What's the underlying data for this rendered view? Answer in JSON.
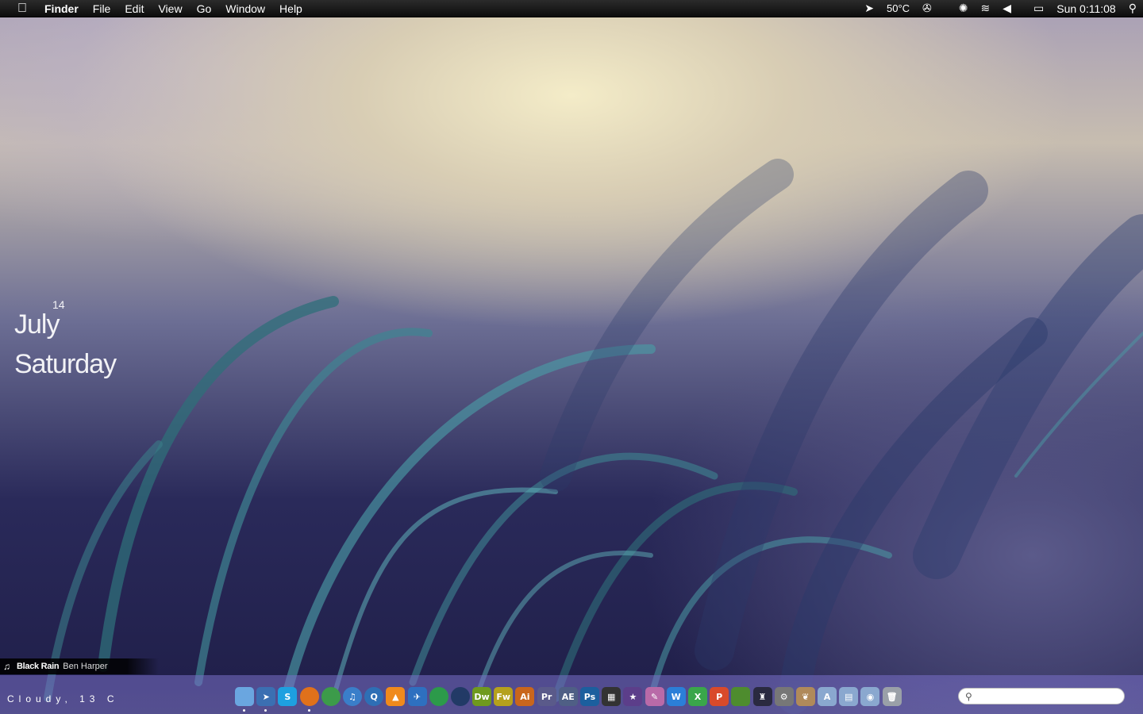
{
  "menubar": {
    "apple_icon": "apple-icon",
    "app_name": "Finder",
    "menus": [
      "File",
      "Edit",
      "View",
      "Go",
      "Window",
      "Help"
    ],
    "temperature": "50°C",
    "clock": "Sun 0:11:08",
    "status_icons": [
      "cursor-icon",
      "fan-icon",
      "network-icon",
      "wifi-icon",
      "volume-icon",
      "battery-icon",
      "spotlight-icon"
    ]
  },
  "date_widget": {
    "day": "14",
    "month": "July",
    "weekday": "Saturday"
  },
  "now_playing": {
    "track": "Black Rain",
    "artist": "Ben Harper"
  },
  "weather": {
    "text": "Cloudy, 13 C"
  },
  "dock": {
    "apps": [
      {
        "name": "finder",
        "label": "",
        "color": "#6aa6e0",
        "running": true
      },
      {
        "name": "cursor-app",
        "label": "➤",
        "color": "#3b6fb2",
        "running": true
      },
      {
        "name": "skype",
        "label": "S",
        "color": "#1ea0e0",
        "running": false
      },
      {
        "name": "firefox",
        "label": "",
        "color": "#e0711b",
        "running": true
      },
      {
        "name": "chrome",
        "label": "",
        "color": "#3c9b4a",
        "running": false
      },
      {
        "name": "itunes",
        "label": "♫",
        "color": "#3a7ec9",
        "running": false
      },
      {
        "name": "quicktime",
        "label": "Q",
        "color": "#2e6fb5",
        "running": false
      },
      {
        "name": "vlc",
        "label": "▲",
        "color": "#f08a1c",
        "running": false
      },
      {
        "name": "adium",
        "label": "✈",
        "color": "#2e70c0",
        "running": false
      },
      {
        "name": "camino",
        "label": "",
        "color": "#2c9a4a",
        "running": false
      },
      {
        "name": "cinema4d",
        "label": "",
        "color": "#223a66",
        "running": false
      },
      {
        "name": "dreamweaver",
        "label": "Dw",
        "color": "#6f9a1e",
        "running": false
      },
      {
        "name": "fireworks",
        "label": "Fw",
        "color": "#b5a11d",
        "running": false
      },
      {
        "name": "illustrator",
        "label": "Ai",
        "color": "#c9661c",
        "running": false
      },
      {
        "name": "premiere",
        "label": "Pr",
        "color": "#5a5a8a",
        "running": false
      },
      {
        "name": "after-effects",
        "label": "AE",
        "color": "#4f5f85",
        "running": false
      },
      {
        "name": "photoshop",
        "label": "Ps",
        "color": "#1c5f9e",
        "running": false
      },
      {
        "name": "final-cut",
        "label": "▦",
        "color": "#333333",
        "running": false
      },
      {
        "name": "imovie",
        "label": "★",
        "color": "#5c3e8a",
        "running": false
      },
      {
        "name": "pencil",
        "label": "✎",
        "color": "#b96aa8",
        "running": false
      },
      {
        "name": "word",
        "label": "W",
        "color": "#2b7fd8",
        "running": false
      },
      {
        "name": "excel",
        "label": "X",
        "color": "#3aa64a",
        "running": false
      },
      {
        "name": "powerpoint",
        "label": "P",
        "color": "#d94a2a",
        "running": false
      },
      {
        "name": "minecraft",
        "label": "",
        "color": "#4e8c2e",
        "running": false
      },
      {
        "name": "wizard",
        "label": "♜",
        "color": "#2a2a40",
        "running": false
      },
      {
        "name": "system-prefs",
        "label": "⚙",
        "color": "#777777",
        "running": false
      },
      {
        "name": "squirrel",
        "label": "❦",
        "color": "#b08a5a",
        "running": false
      },
      {
        "name": "applications-folder",
        "label": "A",
        "color": "#8aa8cf",
        "running": false
      },
      {
        "name": "documents-folder",
        "label": "▤",
        "color": "#8aa8cf",
        "running": false
      },
      {
        "name": "downloads-folder",
        "label": "◉",
        "color": "#8aa8cf",
        "running": false
      },
      {
        "name": "trash",
        "label": "🗑",
        "color": "#9aa0a8",
        "running": false
      }
    ]
  },
  "search": {
    "icon": "search-icon",
    "placeholder": ""
  }
}
